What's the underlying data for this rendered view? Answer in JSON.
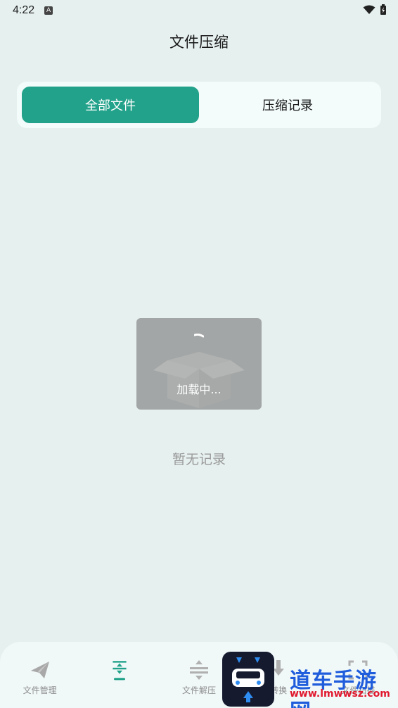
{
  "status": {
    "time": "4:22",
    "a_label": "A"
  },
  "title": "文件压缩",
  "tabs": [
    {
      "label": "全部文件",
      "active": true
    },
    {
      "label": "压缩记录",
      "active": false
    }
  ],
  "loading": {
    "text": "加载中..."
  },
  "empty": {
    "text": "暂无记录"
  },
  "nav": [
    {
      "label": "文件管理",
      "icon": "send-icon",
      "active": false
    },
    {
      "label": "",
      "icon": "compress-icon",
      "active": true
    },
    {
      "label": "文件解压",
      "icon": "decompress-icon",
      "active": false
    },
    {
      "label": "转换",
      "icon": "download-icon",
      "active": false
    },
    {
      "label": "文件扫描",
      "icon": "scan-icon",
      "active": false
    }
  ],
  "watermark": {
    "title": "道车手游网",
    "url": "www.lmwwsz.com"
  },
  "colors": {
    "accent": "#22a28a",
    "background": "#e6f0ef"
  }
}
